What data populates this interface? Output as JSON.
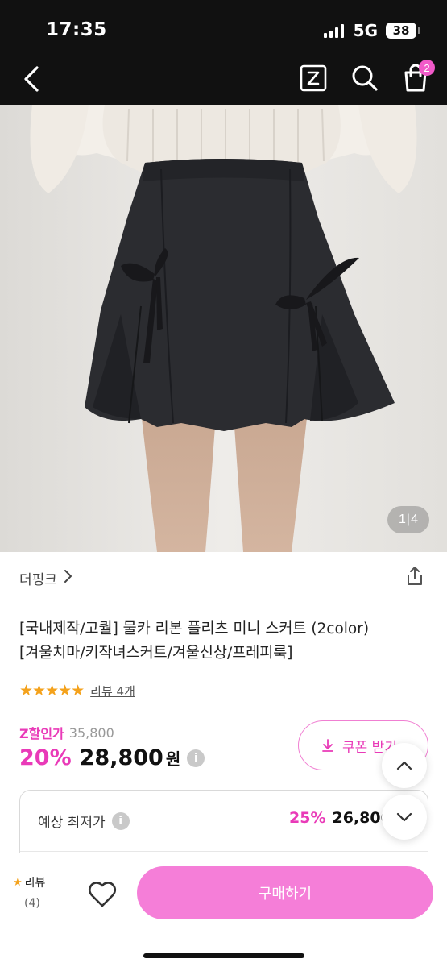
{
  "status_bar": {
    "time": "17:35",
    "network": "5G",
    "battery": "38"
  },
  "nav": {
    "z_icon": "Z",
    "cart_count": "2"
  },
  "gallery": {
    "current": "1",
    "separator": "|",
    "total": "4"
  },
  "seller": {
    "name": "더핑크"
  },
  "product": {
    "title_line1": "[국내제작/고퀄] 물카 리본 플리츠 미니 스커트 (2color)",
    "title_line2": "[겨울치마/키작녀스커트/겨울신상/프레피룩]",
    "stars": "★★★★★",
    "review_link": "리뷰 4개"
  },
  "price": {
    "z_label": "Z할인가",
    "original": "35,800",
    "discount": "20%",
    "final": "28,800",
    "currency": "원"
  },
  "coupon": {
    "label": "쿠폰 받기"
  },
  "lowest": {
    "label": "예상 최저가",
    "discount": "25%",
    "price": "26,800"
  },
  "bottom": {
    "review_label": "리뷰",
    "review_count": "(4)",
    "buy_label": "구매하기"
  },
  "colors": {
    "accent": "#e93ab8",
    "buy_button": "#f57ed8",
    "star": "#f4a21c"
  }
}
